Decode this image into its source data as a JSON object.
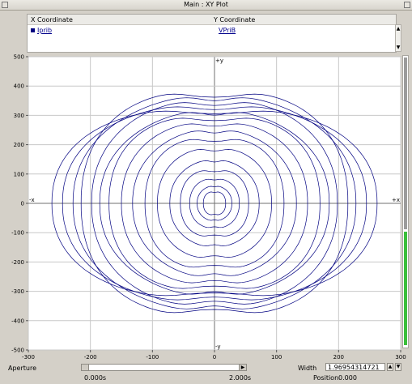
{
  "window": {
    "title": "Main : XY Plot"
  },
  "legend": {
    "x_header": "X Coordinate",
    "y_header": "Y Coordinate",
    "x_signal": "Iprib",
    "y_signal": "VPriB",
    "series_color": "#000080"
  },
  "chart_data": {
    "type": "line",
    "title": "",
    "xlabel": "",
    "ylabel": "",
    "xlim": [
      -300,
      300
    ],
    "ylim": [
      -500,
      500
    ],
    "x_ticks": [
      "-300",
      "-200",
      "-100",
      "0",
      "100",
      "200",
      "300"
    ],
    "y_ticks": [
      "500",
      "400",
      "300",
      "200",
      "100",
      "0",
      "-100",
      "-200",
      "-300",
      "-400",
      "-500"
    ],
    "axis_markers": {
      "pos_y": "+y",
      "neg_y": "-y",
      "pos_x": "+x",
      "neg_x": "-x"
    },
    "grid": true,
    "series": [
      {
        "color": "#000080",
        "loops": [
          {
            "ax": 262,
            "ay": 325
          },
          {
            "ax": 245,
            "ay": 340
          },
          {
            "ax": 228,
            "ay": 372
          },
          {
            "ax": 215,
            "ay": 385
          },
          {
            "ax": 198,
            "ay": 355
          },
          {
            "ax": 185,
            "ay": 320
          },
          {
            "ax": 170,
            "ay": 300
          },
          {
            "ax": 150,
            "ay": 280
          },
          {
            "ax": 132,
            "ay": 255
          },
          {
            "ax": 112,
            "ay": 225
          },
          {
            "ax": 92,
            "ay": 190
          },
          {
            "ax": 72,
            "ay": 150
          },
          {
            "ax": 55,
            "ay": 115
          },
          {
            "ax": 40,
            "ay": 85
          },
          {
            "ax": 28,
            "ay": 60
          },
          {
            "ax": 18,
            "ay": 40
          }
        ]
      }
    ]
  },
  "controls": {
    "aperture_label": "Aperture",
    "time_start": "0.000s",
    "time_end": "2.000s",
    "width_label": "Width",
    "width_value": "1.96954314721",
    "position_label": "Position",
    "position_value": "0.000"
  }
}
